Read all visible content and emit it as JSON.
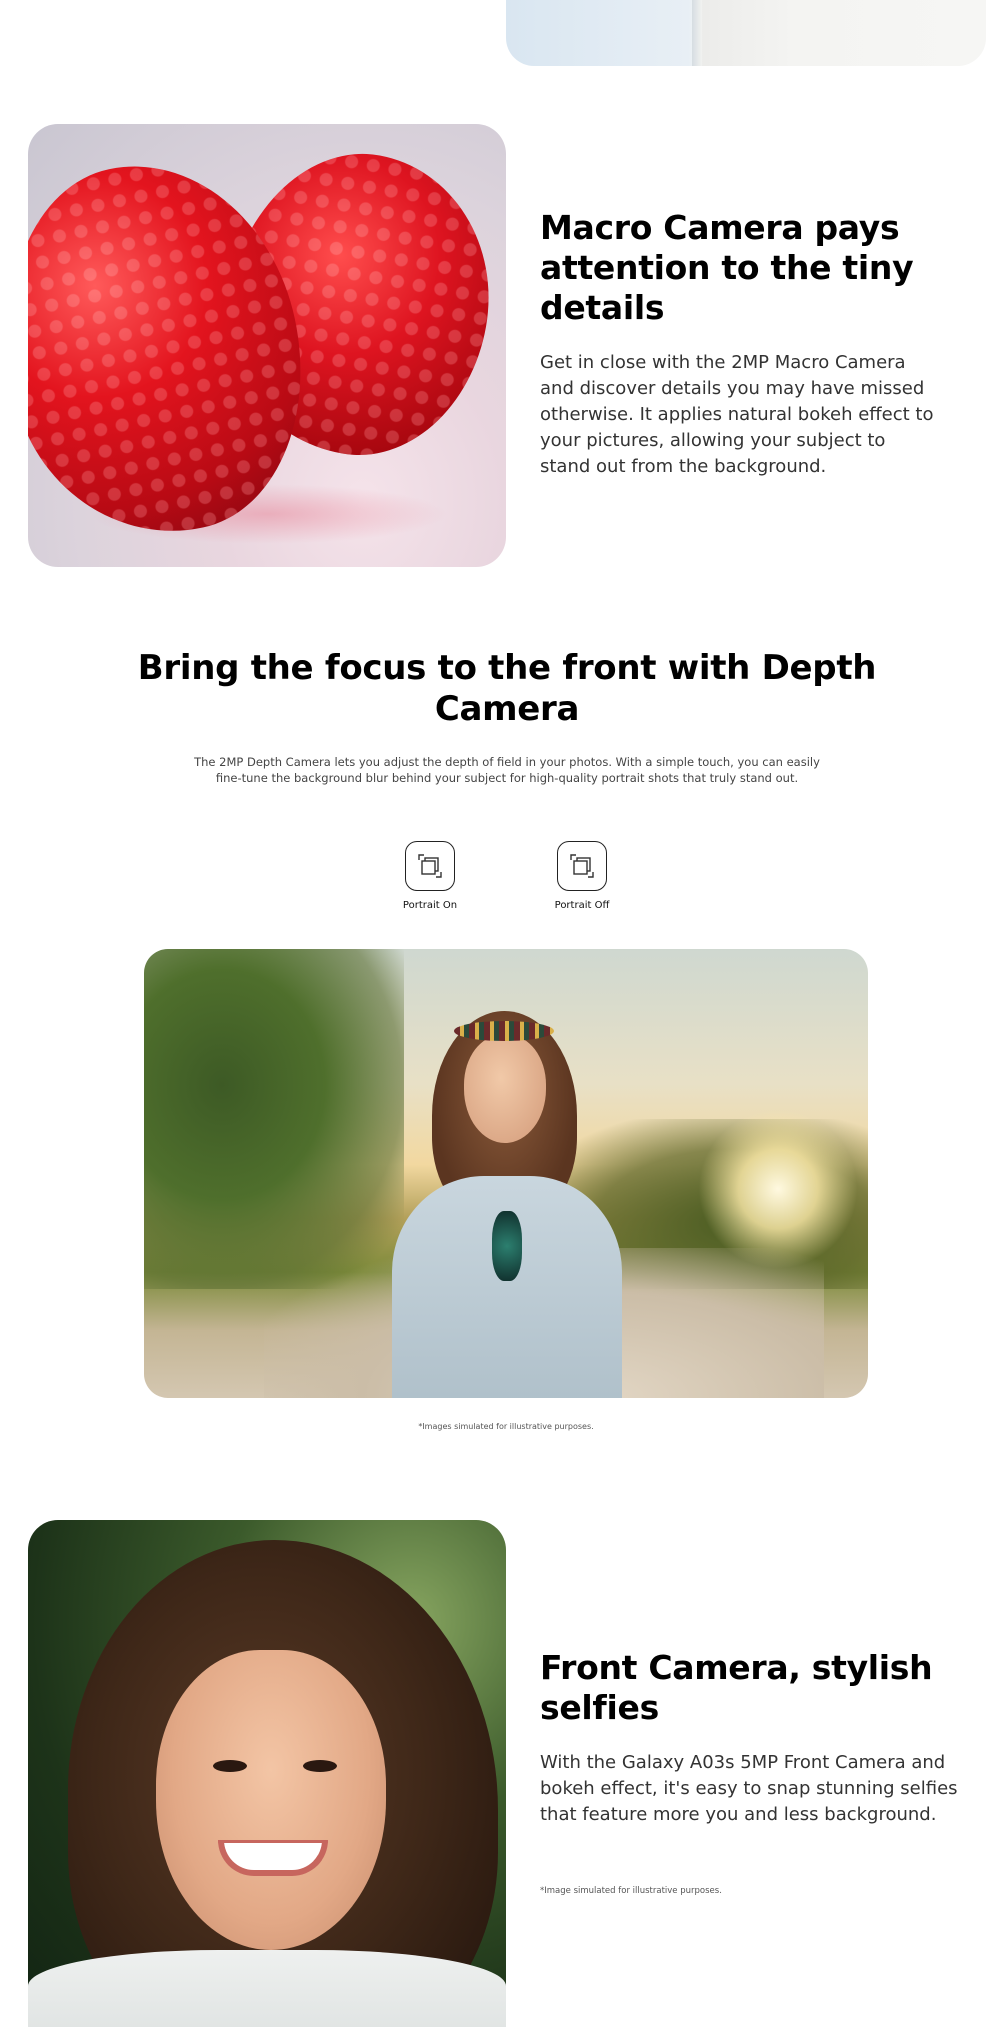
{
  "macro": {
    "title": "Macro Camera pays attention to the tiny details",
    "body": "Get in close with the 2MP Macro Camera and discover details you may have missed otherwise. It applies natural bokeh effect to your pictures, allowing your subject to stand out from the background."
  },
  "depth": {
    "title": "Bring the focus to the front with Depth Camera",
    "body": "The 2MP Depth Camera lets you adjust the depth of field in your photos. With a simple touch, you can easily fine-tune the background blur behind your subject for high-quality portrait shots that truly stand out.",
    "modes": [
      {
        "label": "Portrait On",
        "icon": "portrait-mode-icon"
      },
      {
        "label": "Portrait Off",
        "icon": "portrait-mode-icon"
      }
    ],
    "note": "*Images simulated for illustrative purposes."
  },
  "front": {
    "title": "Front Camera, stylish selfies",
    "body": "With the Galaxy A03s 5MP Front Camera and bokeh effect, it's easy to snap stunning selfies that feature more you and less background.",
    "note": "*Image simulated for illustrative purposes."
  }
}
